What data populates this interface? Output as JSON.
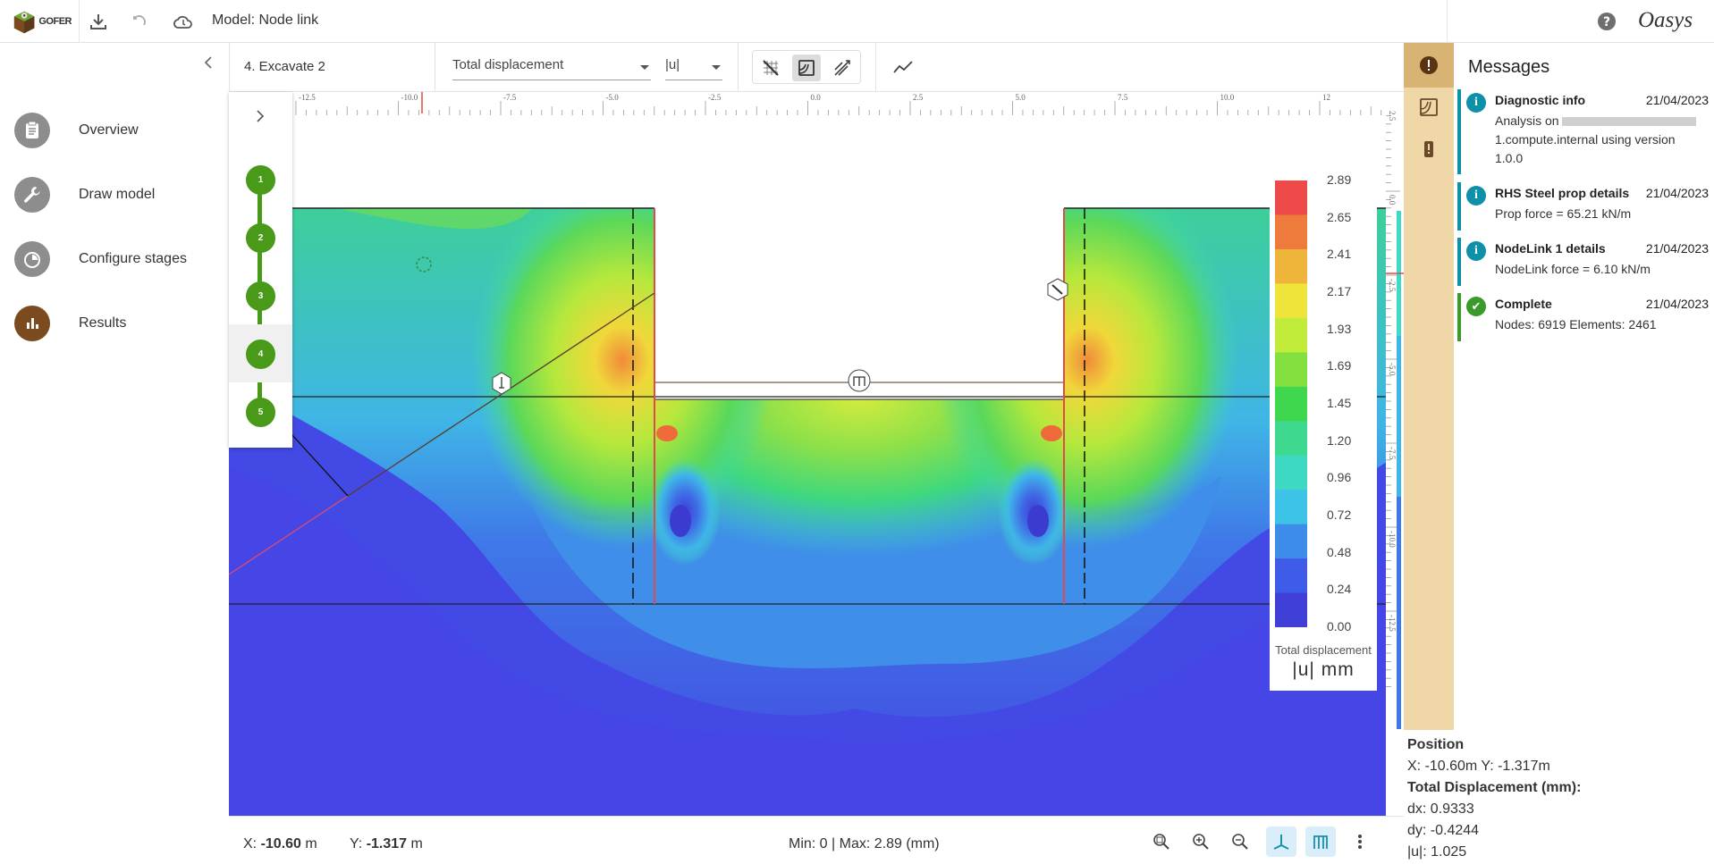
{
  "app": {
    "logo_text": "GOFER",
    "model_title": "Model: Node link",
    "brand": "Oasys"
  },
  "nav": {
    "items": [
      {
        "label": "Overview",
        "icon": "clipboard-icon"
      },
      {
        "label": "Draw model",
        "icon": "wrench-icon"
      },
      {
        "label": "Configure stages",
        "icon": "stopwatch-icon"
      },
      {
        "label": "Results",
        "icon": "bar-chart-icon"
      }
    ],
    "active_index": 3
  },
  "viewbar": {
    "stage": "4. Excavate 2",
    "result_type": "Total displacement",
    "component": "|u|"
  },
  "stepper": {
    "steps": [
      "1",
      "2",
      "3",
      "4",
      "5"
    ],
    "active_index": 3
  },
  "rulers": {
    "top_ticks": [
      "-12.5",
      "-10.0",
      "-7.5",
      "-5.0",
      "-2.5",
      "0.0",
      "2.5",
      "5.0",
      "7.5",
      "10.0",
      "12"
    ],
    "side_ticks": [
      "2.5",
      "0.0",
      "-2.5",
      "-5.0",
      "-7.5",
      "-10.0",
      "-12.5"
    ]
  },
  "legend": {
    "title": "Total displacement",
    "unit": "|u| mm",
    "ticks": [
      "2.89",
      "2.65",
      "2.41",
      "2.17",
      "1.93",
      "1.69",
      "1.45",
      "1.20",
      "0.96",
      "0.72",
      "0.48",
      "0.24",
      "0.00"
    ],
    "colors": [
      "#ef4a4a",
      "#ee7a3c",
      "#efb43a",
      "#eee43a",
      "#c2ec3a",
      "#84e03e",
      "#3ed74e",
      "#3ed88e",
      "#3ed9c2",
      "#3ec3e8",
      "#3e8cea",
      "#3e5ce8",
      "#3f3fd8"
    ]
  },
  "status": {
    "x_label": "X:",
    "x_value": "-10.60",
    "x_unit": "m",
    "y_label": "Y:",
    "y_value": "-1.317",
    "y_unit": "m",
    "minmax": "Min: 0 | Max: 2.89 (mm)"
  },
  "messages": {
    "title": "Messages",
    "items": [
      {
        "type": "info",
        "title": "Diagnostic info",
        "date": "21/04/2023",
        "body_prefix": "Analysis on",
        "body_suffix": "1.compute.internal using version 1.0.0"
      },
      {
        "type": "info",
        "title": "RHS Steel prop details",
        "date": "21/04/2023",
        "body": "Prop force = 65.21 kN/m"
      },
      {
        "type": "info",
        "title": "NodeLink 1 details",
        "date": "21/04/2023",
        "body": "NodeLink force =  6.10 kN/m"
      },
      {
        "type": "ok",
        "title": "Complete",
        "date": "21/04/2023",
        "body": "Nodes: 6919 Elements: 2461"
      }
    ]
  },
  "position": {
    "heading": "Position",
    "coords": "X: -10.60m Y: -1.317m",
    "disp_heading": "Total Displacement (mm):",
    "dx": "dx: 0.9333",
    "dy": "dy: -0.4244",
    "u": "|u|: 1.025"
  }
}
